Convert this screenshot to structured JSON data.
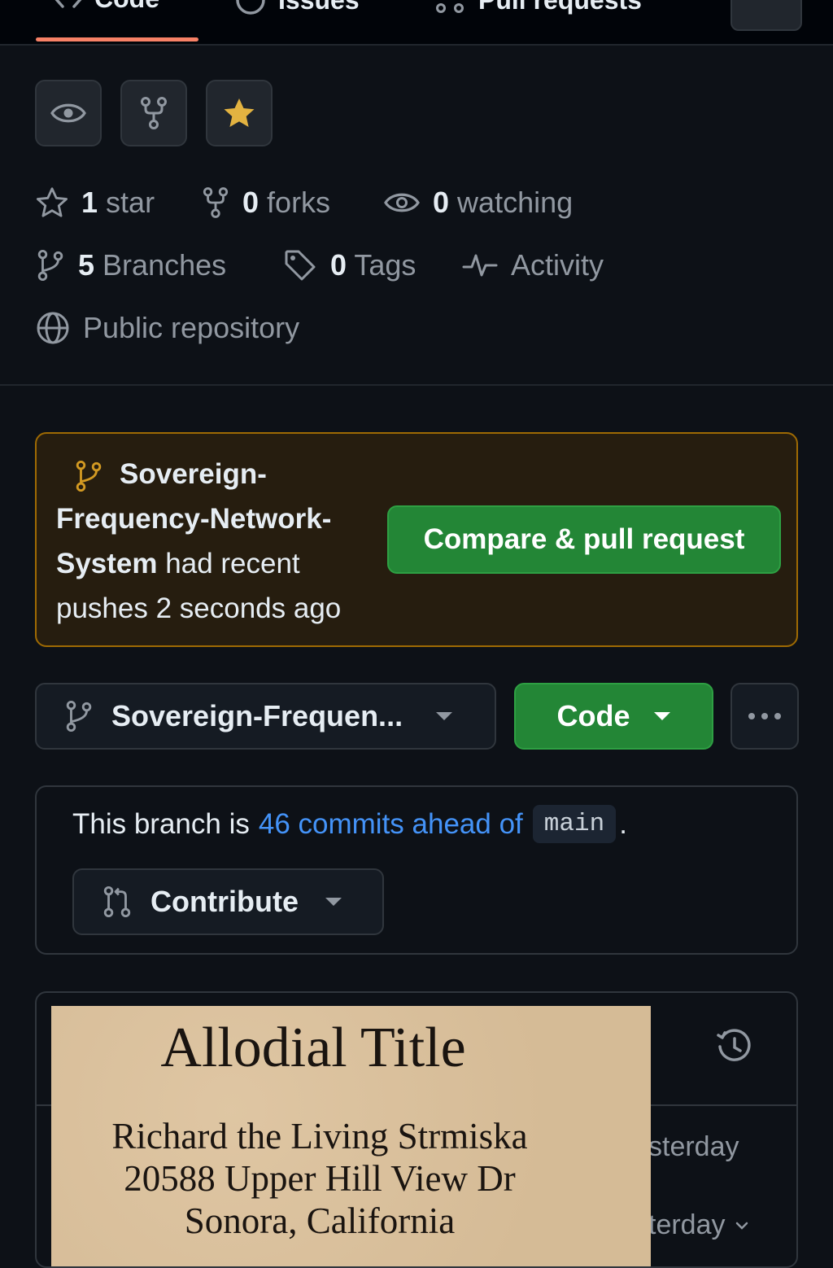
{
  "nav": {
    "tabs": [
      {
        "label": "Code",
        "icon": "code-icon"
      },
      {
        "label": "Issues",
        "icon": "issue-opened-icon"
      },
      {
        "label": "Pull requests",
        "icon": "git-pull-request-icon"
      }
    ]
  },
  "stats": {
    "stars_count": "1",
    "stars_label": "star",
    "forks_count": "0",
    "forks_label": "forks",
    "watching_count": "0",
    "watching_label": "watching",
    "branches_count": "5",
    "branches_label": "Branches",
    "tags_count": "0",
    "tags_label": "Tags",
    "activity_label": "Activity",
    "visibility_label": "Public repository"
  },
  "banner": {
    "branch_name_lines": [
      "Sovereign-",
      "Frequency-Network-",
      "System"
    ],
    "had_recent": "had recent",
    "pushes_time": "pushes 2 seconds ago",
    "compare_button": "Compare & pull request"
  },
  "branch_bar": {
    "selected_branch": "Sovereign-Frequen...",
    "code_button": "Code"
  },
  "ahead": {
    "prefix": "This branch is",
    "link": "46 commits ahead of",
    "base_branch": "main",
    "suffix": ".",
    "contribute_button": "Contribute"
  },
  "files": {
    "row1_time": "sterday",
    "row2_time": "terday"
  },
  "overlay_image": {
    "title": "Allodial Title",
    "line1": "Richard the Living Strmiska",
    "line2": "20588 Upper Hill View Dr",
    "line3": "Sonora, California"
  },
  "colors": {
    "accent_green": "#238636",
    "link_blue": "#4493f8",
    "star_yellow": "#e3b341",
    "banner_border": "#9e6a03",
    "tab_underline": "#f78166"
  }
}
